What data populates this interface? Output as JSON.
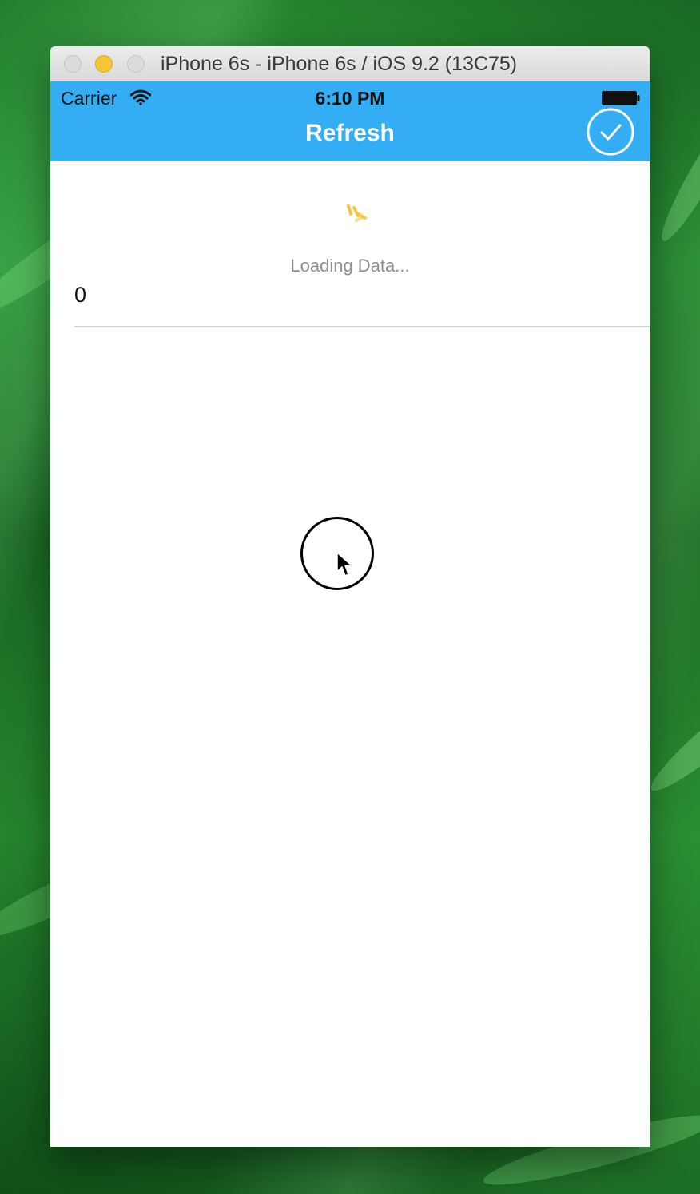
{
  "window": {
    "title": "iPhone 6s - iPhone 6s / iOS 9.2 (13C75)"
  },
  "status_bar": {
    "carrier": "Carrier",
    "time": "6:10 PM",
    "wifi_icon": "wifi-icon",
    "battery_icon": "battery-icon"
  },
  "navbar": {
    "title": "Refresh",
    "right_button_icon": "checkmark-circle-icon",
    "background_color": "#33aef4"
  },
  "refresh_control": {
    "spinner_icon": "activity-spinner-icon",
    "spinner_color": "#f5c344",
    "status_text": "Loading Data..."
  },
  "list": {
    "rows": [
      {
        "label": "0"
      }
    ]
  },
  "pointer": {
    "icon": "arrow-cursor-icon",
    "touch_indicator": "touch-circle"
  }
}
